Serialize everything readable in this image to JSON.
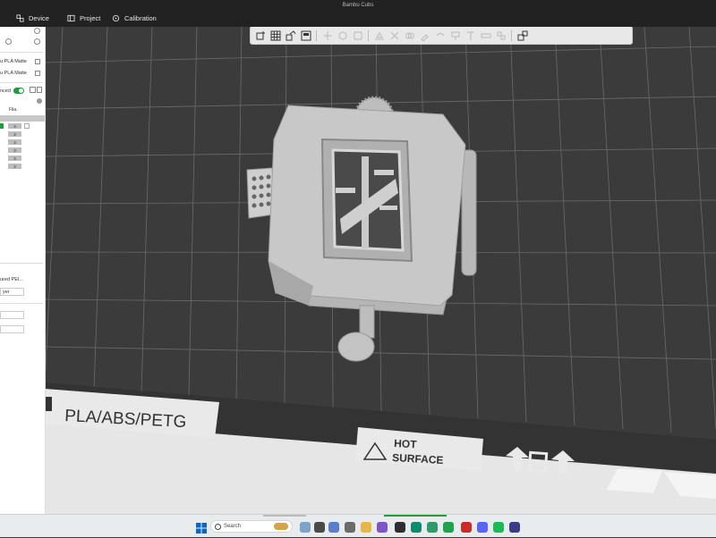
{
  "window": {
    "title": "Bambu Cubs"
  },
  "nav": {
    "device_label": "Device",
    "project_label": "Project",
    "calibration_label": "Calibration"
  },
  "left_panel": {
    "filament1": "u PLA Matte",
    "filament2": "u PLA Matte",
    "advanced_label": "nced",
    "table_header": "Fila.",
    "filament_slots": [
      "3",
      "3",
      "3",
      "3",
      "3",
      "3"
    ],
    "plate_type": "ured PEI...",
    "layer_label": "yer"
  },
  "bed": {
    "material_text": "PLA/ABS/PETG",
    "hot_label": "HOT",
    "surface_label": "SURFACE"
  },
  "taskbar": {
    "search_placeholder": "Search"
  },
  "colors": {
    "background": "#3d3d3d",
    "accent_green": "#1b9e3e",
    "model_gray": "#c8c8c8",
    "bed_plate": "#e6e6e6"
  }
}
